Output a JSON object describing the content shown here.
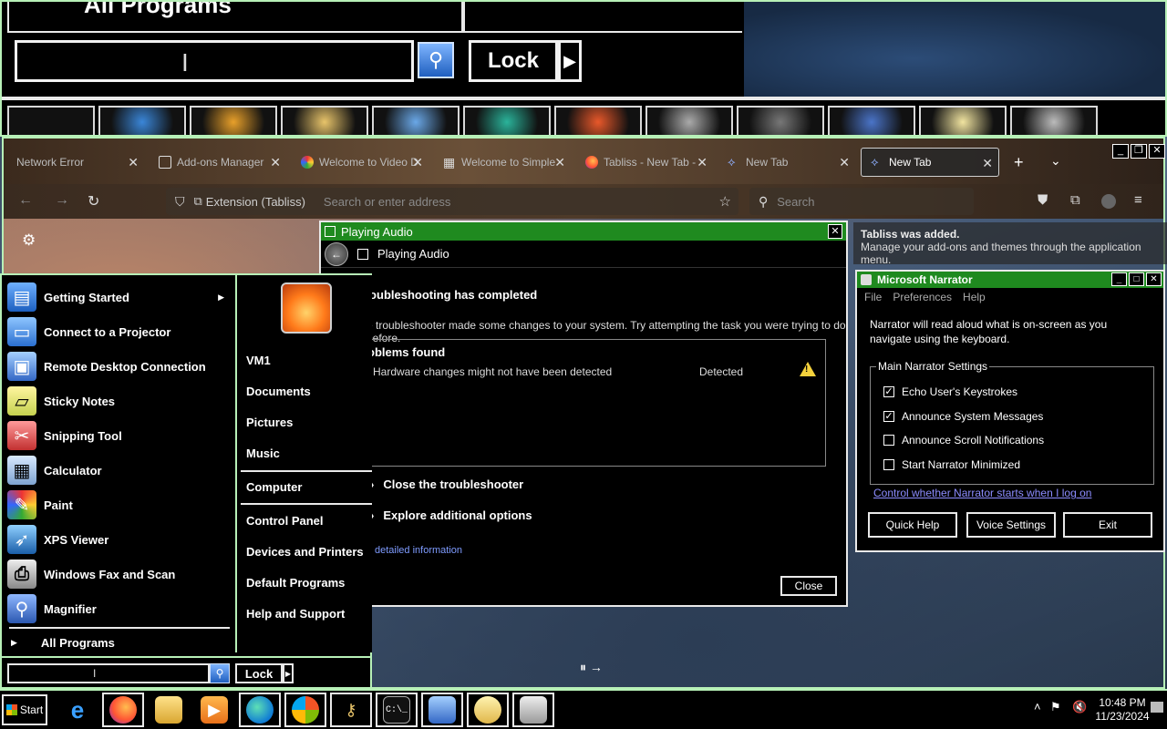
{
  "magnifier": {
    "all_programs_label": "All Programs",
    "lock_label": "Lock",
    "lock_arrow": "▶"
  },
  "firefox": {
    "tabs": [
      {
        "label": "Network Error"
      },
      {
        "label": "Add-ons Manager"
      },
      {
        "label": "Welcome to Video D"
      },
      {
        "label": "Welcome to Simple"
      },
      {
        "label": "Tabliss - New Tab -"
      },
      {
        "label": "New Tab"
      },
      {
        "label": "New Tab"
      }
    ],
    "url_extension_chip": "Extension (Tabliss)",
    "url_placeholder": "Search or enter address",
    "search_placeholder": "Search",
    "notification": {
      "title": "Tabliss was added.",
      "body": "Manage your add-ons and themes through the application menu."
    }
  },
  "start_menu": {
    "programs": [
      {
        "label": "Getting Started",
        "icon": "getting-started-icon",
        "has_submenu": true
      },
      {
        "label": "Connect to a Projector",
        "icon": "projector-icon"
      },
      {
        "label": "Remote Desktop Connection",
        "icon": "remote-desktop-icon"
      },
      {
        "label": "Sticky Notes",
        "icon": "sticky-notes-icon"
      },
      {
        "label": "Snipping Tool",
        "icon": "snipping-tool-icon"
      },
      {
        "label": "Calculator",
        "icon": "calculator-icon"
      },
      {
        "label": "Paint",
        "icon": "paint-icon"
      },
      {
        "label": "XPS Viewer",
        "icon": "xps-viewer-icon"
      },
      {
        "label": "Windows Fax and Scan",
        "icon": "fax-scan-icon"
      },
      {
        "label": "Magnifier",
        "icon": "magnifier-icon"
      }
    ],
    "all_programs": "All Programs",
    "right_links": [
      {
        "label": "VM1"
      },
      {
        "label": "Documents"
      },
      {
        "label": "Pictures"
      },
      {
        "label": "Music"
      },
      {
        "label": "Computer"
      },
      {
        "label": "Control Panel"
      },
      {
        "label": "Devices and Printers"
      },
      {
        "label": "Default Programs"
      },
      {
        "label": "Help and Support"
      }
    ],
    "lock_label": "Lock"
  },
  "troubleshooter": {
    "window_title": "Playing Audio",
    "header_title": "Playing Audio",
    "heading": "roubleshooting has completed",
    "message": "e troubleshooter made some changes to your system. Try attempting the task you were trying to do before.",
    "problems_heading": "oblems found",
    "problem": {
      "text": "Hardware changes might not have been detected",
      "status": "Detected"
    },
    "options": [
      "Close the troubleshooter",
      "Explore additional options"
    ],
    "details_link": "w detailed information",
    "close_label": "Close"
  },
  "narrator": {
    "title": "Microsoft Narrator",
    "menu": [
      "File",
      "Preferences",
      "Help"
    ],
    "description": "Narrator will read aloud what is on-screen as you navigate using the keyboard.",
    "group_label": "Main Narrator Settings",
    "settings": [
      {
        "label": "Echo User's Keystrokes",
        "checked": true
      },
      {
        "label": "Announce System Messages",
        "checked": true
      },
      {
        "label": "Announce Scroll Notifications",
        "checked": false
      },
      {
        "label": "Start Narrator Minimized",
        "checked": false
      }
    ],
    "link": "Control whether Narrator starts when I log on",
    "buttons": [
      "Quick Help",
      "Voice Settings",
      "Exit"
    ]
  },
  "taskbar": {
    "start_label": "Start",
    "apps": [
      {
        "name": "internet-explorer-icon"
      },
      {
        "name": "firefox-icon"
      },
      {
        "name": "file-explorer-icon"
      },
      {
        "name": "media-player-icon"
      },
      {
        "name": "edge-icon"
      },
      {
        "name": "windows-update-icon"
      },
      {
        "name": "credential-manager-icon"
      },
      {
        "name": "command-prompt-icon"
      },
      {
        "name": "remote-desktop-icon"
      },
      {
        "name": "chat-icon"
      },
      {
        "name": "narrator-app-icon"
      }
    ],
    "clock": {
      "time": "10:48 PM",
      "date": "11/23/2024"
    }
  },
  "colors": {
    "title_green": "#1f8a1f",
    "border_highlight": "#b7f0b7",
    "link_blue": "#8c8cff"
  }
}
